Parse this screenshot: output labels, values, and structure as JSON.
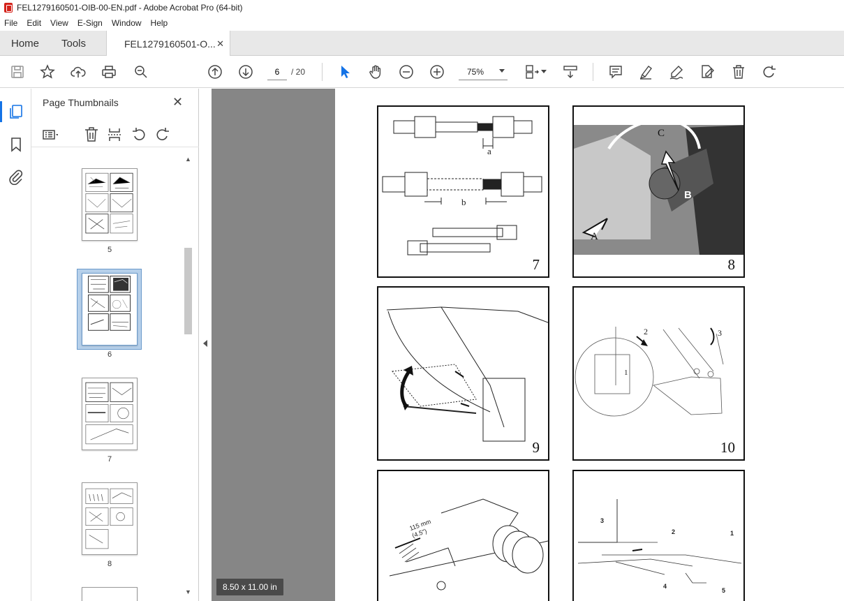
{
  "window": {
    "title": "FEL1279160501-OIB-00-EN.pdf - Adobe Acrobat Pro (64-bit)"
  },
  "menu": [
    "File",
    "Edit",
    "View",
    "E-Sign",
    "Window",
    "Help"
  ],
  "tabs": {
    "home": "Home",
    "tools": "Tools",
    "document": "FEL1279160501-O..."
  },
  "toolbar": {
    "current_page": "6",
    "page_total": "/ 20",
    "zoom": "75%"
  },
  "thumbnails_panel": {
    "title": "Page Thumbnails",
    "pages": [
      {
        "label": "5",
        "selected": false
      },
      {
        "label": "6",
        "selected": true
      },
      {
        "label": "7",
        "selected": false
      },
      {
        "label": "8",
        "selected": false
      }
    ]
  },
  "document": {
    "figures": [
      {
        "number": "7",
        "labels": [
          "a",
          "b"
        ]
      },
      {
        "number": "8",
        "labels": [
          "A",
          "B",
          "C"
        ]
      },
      {
        "number": "9",
        "labels": []
      },
      {
        "number": "10",
        "labels": [
          "1",
          "2",
          "3"
        ]
      },
      {
        "number": "",
        "labels": [
          "115 mm",
          "(4.5\")"
        ]
      },
      {
        "number": "",
        "labels": [
          "1",
          "2",
          "3",
          "4",
          "5"
        ]
      }
    ],
    "page_size": "8.50 x 11.00 in"
  }
}
